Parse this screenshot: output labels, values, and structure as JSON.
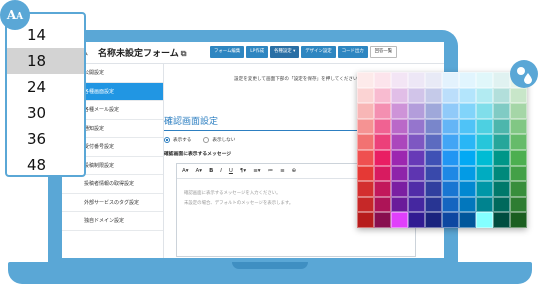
{
  "header": {
    "back_mark": "ム",
    "title": "名称未設定フォーム",
    "toolbar": [
      {
        "label": "フォーム編集",
        "icon": "form-icon"
      },
      {
        "label": "LP作成",
        "icon": "lp-icon"
      },
      {
        "label": "各種設定 ▾",
        "icon": "gear-icon"
      },
      {
        "label": "デザイン設定",
        "icon": "design-icon"
      },
      {
        "label": "コード出力",
        "icon": "code-icon"
      },
      {
        "label": "回答一覧",
        "icon": "list-icon"
      }
    ]
  },
  "sidebar": {
    "items": [
      {
        "label": "公開設定"
      },
      {
        "label": "各種画面設定"
      },
      {
        "label": "各種メール設定"
      },
      {
        "label": "通知設定"
      },
      {
        "label": "受付番号設定"
      },
      {
        "label": "投稿制限設定"
      },
      {
        "label": "投稿者情報の取得設定"
      },
      {
        "label": "外部サービスのタグ設定"
      },
      {
        "label": "独自ドメイン設定"
      }
    ]
  },
  "main": {
    "note": "設定を変更して画面下部の「設定を保存」を押してください。",
    "section_title": "確認画面設定",
    "radio_show": "表示する",
    "radio_hide": "表示しない",
    "message_label": "確認画面に表示するメッセージ",
    "editor_lines": [
      "確認画面に表示するメッセージを入力ください。",
      "未設定の場合、デフォルトのメッセージを表示します。"
    ],
    "editor_tools": [
      "A▾",
      "A▾",
      "B",
      "I",
      "U",
      "¶▾",
      "≡▾",
      "≔",
      "≡",
      "⊕"
    ]
  },
  "font_picker": {
    "badge": "AA",
    "sizes": [
      "14",
      "18",
      "24",
      "30",
      "36",
      "48"
    ],
    "selected": "18"
  },
  "palette": {
    "badge_icon": "palette-drop-icon",
    "colors": [
      [
        "#fdeaea",
        "#fbd3d3",
        "#f8b6b6",
        "#f59393",
        "#f27272",
        "#ef5050",
        "#e53935",
        "#d32f2f",
        "#c62828",
        "#b71c1c"
      ],
      [
        "#fce4ec",
        "#f8bbd0",
        "#f48fb1",
        "#f06292",
        "#ec407a",
        "#e91e63",
        "#d81b60",
        "#c2185b",
        "#ad1457",
        "#880e4f"
      ],
      [
        "#f3e5f5",
        "#e1bee7",
        "#ce93d8",
        "#ba68c8",
        "#ab47bc",
        "#9c27b0",
        "#8e24aa",
        "#7b1fa2",
        "#6a1b9a",
        "#e040fb"
      ],
      [
        "#ede7f6",
        "#d1c4e9",
        "#b39ddb",
        "#9575cd",
        "#7e57c2",
        "#673ab7",
        "#5e35b1",
        "#512da8",
        "#4527a0",
        "#311b92"
      ],
      [
        "#e8eaf6",
        "#c5cae9",
        "#9fa8da",
        "#7986cb",
        "#5c6bc0",
        "#3f51b5",
        "#3949ab",
        "#303f9f",
        "#283593",
        "#1a237e"
      ],
      [
        "#e3f2fd",
        "#bbdefb",
        "#90caf9",
        "#64b5f6",
        "#42a5f5",
        "#2196f3",
        "#1e88e5",
        "#1976d2",
        "#1565c0",
        "#0d47a1"
      ],
      [
        "#e1f5fe",
        "#b3e5fc",
        "#81d4fa",
        "#4fc3f7",
        "#29b6f6",
        "#03a9f4",
        "#039be5",
        "#0288d1",
        "#0277bd",
        "#01579b"
      ],
      [
        "#e0f7fa",
        "#b2ebf2",
        "#80deea",
        "#4dd0e1",
        "#26c6da",
        "#00bcd4",
        "#00acc1",
        "#0097a7",
        "#00838f",
        "#84ffff"
      ],
      [
        "#e0f2f1",
        "#b2dfdb",
        "#80cbc4",
        "#4db6ac",
        "#26a69a",
        "#009688",
        "#00897b",
        "#00796b",
        "#00695c",
        "#004d40"
      ],
      [
        "#e8f5e9",
        "#c8e6c9",
        "#a5d6a7",
        "#81c784",
        "#66bb6a",
        "#4caf50",
        "#43a047",
        "#388e3c",
        "#2e7d32",
        "#1b5e20"
      ]
    ]
  }
}
